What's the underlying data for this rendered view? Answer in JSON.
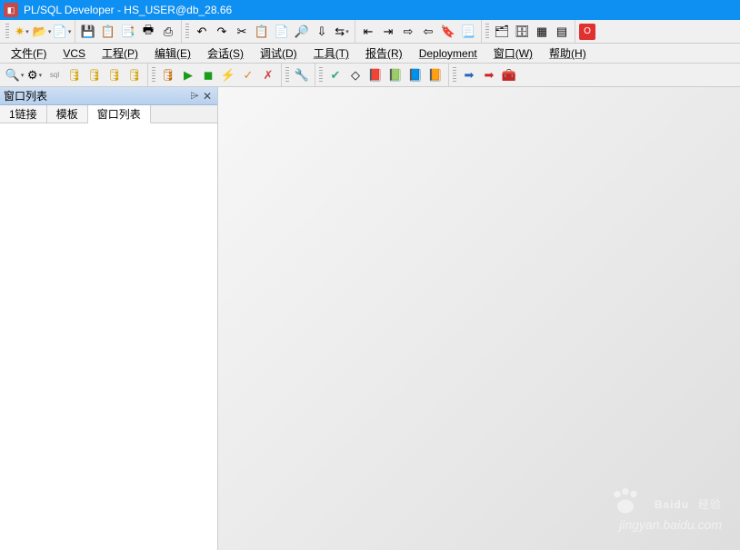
{
  "titlebar": {
    "app": "PL/SQL Developer",
    "connection": "HS_USER@db_28.66"
  },
  "menu": {
    "file": "文件(F)",
    "vcs": "VCS",
    "project": "工程(P)",
    "edit": "编辑(E)",
    "session": "会话(S)",
    "debug": "调试(D)",
    "tools": "工具(T)",
    "report": "报告(R)",
    "deployment": "Deployment",
    "window": "窗口(W)",
    "help": "帮助(H)"
  },
  "toolbar1": {
    "new": "✷",
    "open": "📂",
    "save": "📄",
    "saveall": "💾",
    "copy1": "📋",
    "copy2": "📑",
    "print": "🖶",
    "export": "⎙",
    "undo": "↶",
    "redo": "↷",
    "cut": "✂",
    "copy": "📋",
    "paste": "📄",
    "find": "🔎",
    "findnext": "⇩",
    "replace": "⇆",
    "begin": "⇤",
    "end": "⇥",
    "indent": "⇨",
    "outdent": "⇦",
    "bookmark": "🔖",
    "doc": "📃",
    "obj": "🗂",
    "browser": "🗄",
    "grid": "▦",
    "table": "▤",
    "oracle": "O"
  },
  "toolbar2": {
    "search": "🔍",
    "config": "⚙",
    "sql": "sql",
    "db1": "🛢",
    "db2": "🛢",
    "db3": "🛢",
    "db4": "🛢",
    "kill": "🛢",
    "run1": "▶",
    "stop": "◼",
    "exec": "⚡",
    "commit": "✓",
    "rollback": "✗",
    "wrench": "🔧",
    "check": "✔",
    "clear": "◇",
    "book1": "📕",
    "book2": "📗",
    "book3": "📘",
    "book4": "📙",
    "arrow1": "➡",
    "arrow2": "➡",
    "box": "🧰"
  },
  "panel": {
    "title": "窗口列表",
    "tabs": [
      "1链接",
      "模板",
      "窗口列表"
    ],
    "active_tab": 2
  },
  "watermark": {
    "brand": "Baidu",
    "product": "经验",
    "url": "jingyan.baidu.com"
  }
}
